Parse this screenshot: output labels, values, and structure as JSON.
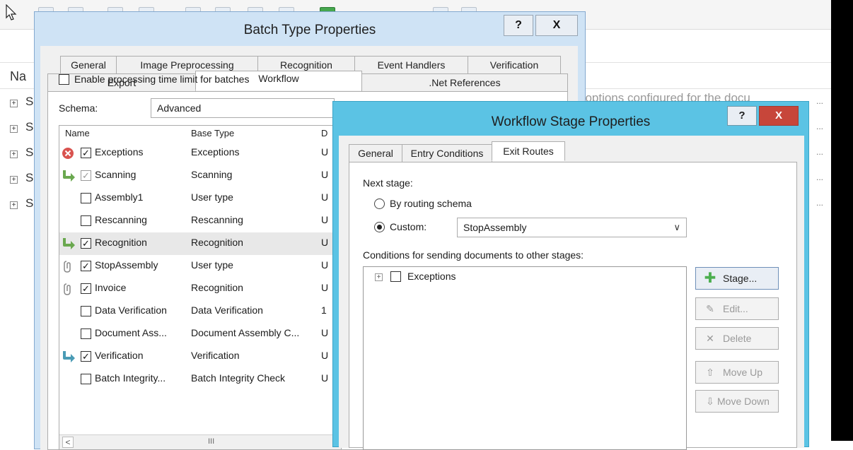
{
  "background": {
    "column_prefix": "Na",
    "row_prefix": "S",
    "row_count": 5,
    "ghost_text": "t options configured for the docu",
    "ellipsis": "..."
  },
  "batch_dialog": {
    "title": "Batch Type Properties",
    "help": "?",
    "close": "X",
    "tabs_row1": [
      "General",
      "Image Preprocessing",
      "Recognition",
      "Event Handlers",
      "Verification"
    ],
    "tabs_row2": [
      "Export",
      "Workflow",
      ".Net References"
    ],
    "active_tab": "Workflow",
    "enable_limit_label": "Enable processing time limit for batches",
    "schema_label": "Schema:",
    "schema_value": "Advanced",
    "columns": [
      "Name",
      "Base Type",
      "D"
    ],
    "stages": [
      {
        "name": "Exceptions",
        "base": "Exceptions",
        "d": "U",
        "checked": true,
        "icon": "error-icon"
      },
      {
        "name": "Scanning",
        "base": "Scanning",
        "d": "U",
        "checked": true,
        "icon": "arrow-icon"
      },
      {
        "name": "Assembly1",
        "base": "User type",
        "d": "U",
        "checked": false,
        "icon": ""
      },
      {
        "name": "Rescanning",
        "base": "Rescanning",
        "d": "U",
        "checked": false,
        "icon": ""
      },
      {
        "name": "Recognition",
        "base": "Recognition",
        "d": "U",
        "checked": true,
        "icon": "arrow-icon"
      },
      {
        "name": "StopAssembly",
        "base": "User type",
        "d": "U",
        "checked": true,
        "icon": "clip-icon"
      },
      {
        "name": "Invoice",
        "base": "Recognition",
        "d": "U",
        "checked": true,
        "icon": "clip-icon"
      },
      {
        "name": "Data Verification",
        "base": "Data Verification",
        "d": "1",
        "checked": false,
        "icon": ""
      },
      {
        "name": "Document Ass...",
        "base": "Document Assembly C...",
        "d": "U",
        "checked": false,
        "icon": ""
      },
      {
        "name": "Verification",
        "base": "Verification",
        "d": "U",
        "checked": true,
        "icon": "return-arrow-icon"
      },
      {
        "name": "Batch Integrity...",
        "base": "Batch Integrity Check",
        "d": "U",
        "checked": false,
        "icon": ""
      }
    ],
    "scroll_left": "<",
    "scroll_grip": "III"
  },
  "stage_dialog": {
    "title": "Workflow Stage Properties",
    "help": "?",
    "close": "X",
    "tabs": [
      "General",
      "Entry Conditions",
      "Exit Routes"
    ],
    "active_tab": "Exit Routes",
    "next_stage_label": "Next stage:",
    "option_routing": "By routing schema",
    "option_custom": "Custom:",
    "custom_value": "StopAssembly",
    "conditions_label": "Conditions for sending documents to other stages:",
    "condition_items": [
      "Exceptions"
    ],
    "buttons": {
      "stage": "Stage...",
      "edit": "Edit...",
      "delete": "Delete",
      "move_up": "Move Up",
      "move_down": "Move Down"
    }
  }
}
